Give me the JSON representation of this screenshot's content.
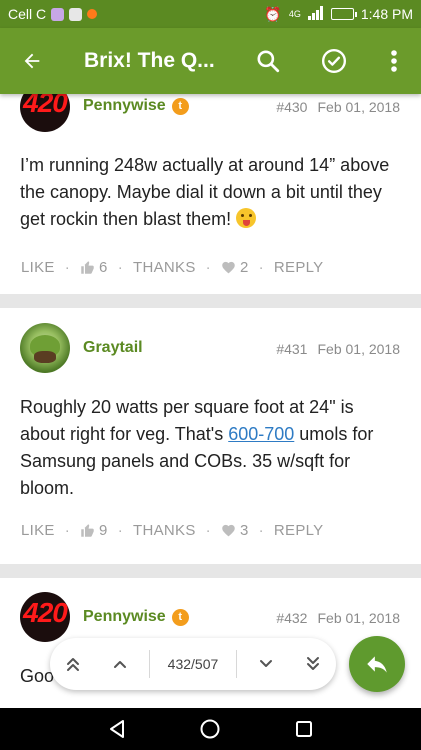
{
  "status_bar": {
    "carrier": "Cell C",
    "network": "4G",
    "time": "1:48 PM"
  },
  "app_bar": {
    "title": "Brix! The Q...",
    "icons": [
      "back-arrow-icon",
      "search-icon",
      "check-circle-icon",
      "more-vert-icon"
    ]
  },
  "posts": [
    {
      "author": "Pennywise",
      "avatar_text": "420",
      "number": "#430",
      "date": "Feb 01, 2018",
      "body": "I’m running 248w actually at around 14” above the canopy. Maybe dial it down a bit until they get rockin then blast them!",
      "actions": {
        "like": "LIKE",
        "likes": "6",
        "thanks": "THANKS",
        "thanks_count": "2",
        "reply": "REPLY"
      }
    },
    {
      "author": "Graytail",
      "number": "#431",
      "date": "Feb 01, 2018",
      "body_before": "Roughly 20 watts per square foot at 24\" is about right for veg. That's ",
      "body_link": "600-700",
      "body_after": " umols for Samsung panels and COBs. 35 w/sqft for bloom.",
      "actions": {
        "like": "LIKE",
        "likes": "9",
        "thanks": "THANKS",
        "thanks_count": "3",
        "reply": "REPLY"
      }
    },
    {
      "author": "Pennywise",
      "avatar_text": "420",
      "number": "#432",
      "date": "Feb 01, 2018",
      "body_partial": "Goo"
    }
  ],
  "pager": {
    "label": "432/507"
  },
  "colors": {
    "status_bar": "#5b8a22",
    "app_bar": "#6b9b2b",
    "author": "#5b8a22",
    "link": "#2e7bc4",
    "badge": "#f39d1c",
    "fab": "#5f9a2e"
  }
}
